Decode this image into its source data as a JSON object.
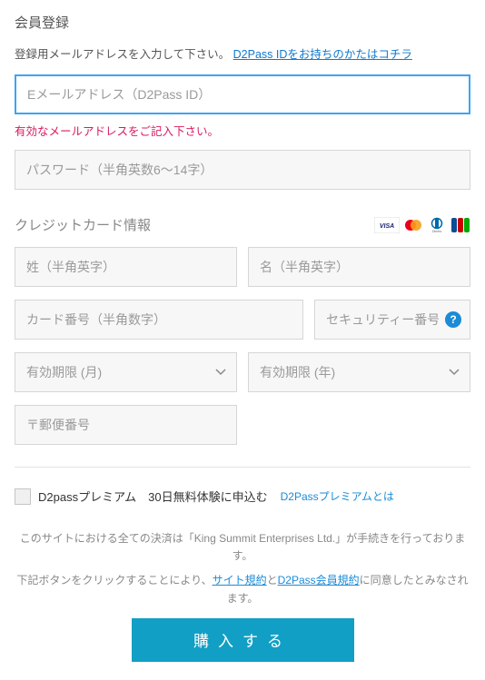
{
  "title": "会員登録",
  "intro_text": "登録用メールアドレスを入力して下さい。",
  "intro_link": "D2Pass IDをお持ちのかたはコチラ",
  "email_placeholder": "Eメールアドレス（D2Pass ID）",
  "email_error": "有効なメールアドレスをご記入下さい。",
  "password_placeholder": "パスワード（半角英数6～14字）",
  "credit_section_title": "クレジットカード情報",
  "lastname_placeholder": "姓（半角英字）",
  "firstname_placeholder": "名（半角英字）",
  "cardnumber_placeholder": "カード番号（半角数字）",
  "securitycode_placeholder": "セキュリティー番号",
  "help_label": "?",
  "exp_month_placeholder": "有効期限 (月)",
  "exp_year_placeholder": "有効期限 (年)",
  "postcode_placeholder": "〒郵便番号",
  "premium_check_label": "D2passプレミアム　30日無料体験に申込む",
  "premium_link": "D2Passプレミアムとは",
  "notice_line1": "このサイトにおける全ての決済は「King Summit Enterprises Ltd.」が手続きを行っております。",
  "notice_line2_pre": "下記ボタンをクリックすることにより、",
  "notice_link1": "サイト規約",
  "notice_and": "と",
  "notice_link2": "D2Pass会員規約",
  "notice_line2_post": "に同意したとみなされます。",
  "submit_label": "購入する",
  "card_brands": [
    "VISA",
    "MasterCard",
    "Diners",
    "JCB"
  ]
}
